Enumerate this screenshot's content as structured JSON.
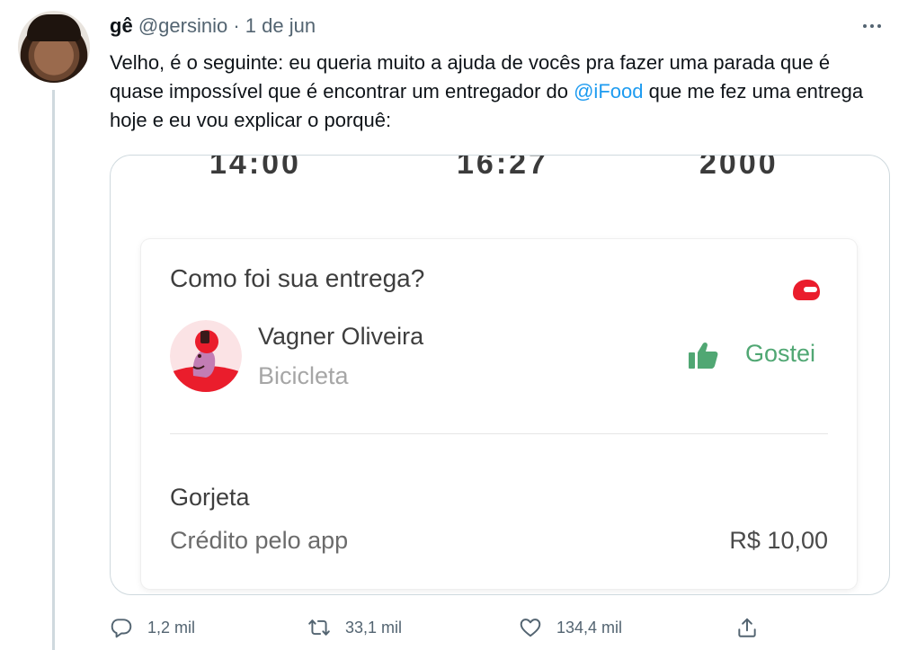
{
  "tweet": {
    "author_name": "gê",
    "author_handle": "@gersinio",
    "separator": "·",
    "date": "1 de jun",
    "text_before_mention": "Velho, é o seguinte: eu queria muito a ajuda de vocês pra fazer uma parada que é quase impossível que é encontrar um entregador do ",
    "mention": "@iFood",
    "text_after_mention": " que me fez uma entrega hoje e eu vou explicar o porquê:"
  },
  "media": {
    "cut_numbers": [
      "14:00",
      "16:27",
      "2000"
    ],
    "card": {
      "title": "Como foi sua entrega?",
      "courier_name": "Vagner Oliveira",
      "courier_vehicle": "Bicicleta",
      "rating_label": "Gostei",
      "tip_title": "Gorjeta",
      "tip_method": "Crédito pelo app",
      "tip_value": "R$ 10,00"
    },
    "colors": {
      "ifood_red": "#ea1d2c",
      "like_green": "#50a773"
    }
  },
  "actions": {
    "reply_count": "1,2 mil",
    "retweet_count": "33,1 mil",
    "like_count": "134,4 mil"
  },
  "icons": [
    "more-icon",
    "helmet-icon",
    "thumbs-up-icon",
    "reply-icon",
    "retweet-icon",
    "like-icon",
    "share-icon"
  ]
}
